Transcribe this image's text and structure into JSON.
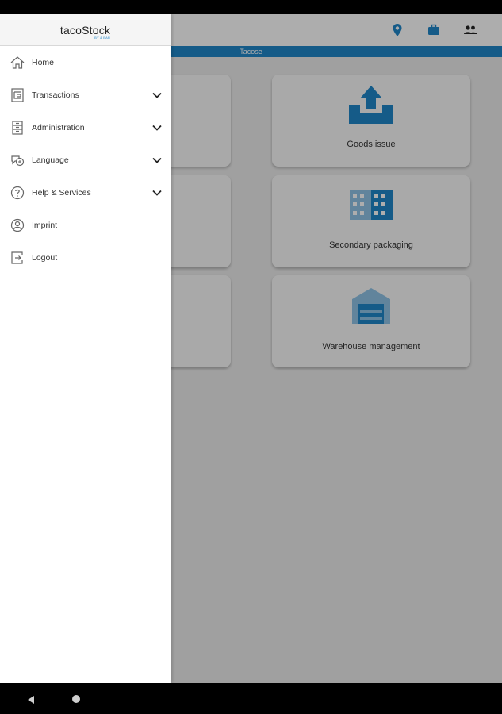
{
  "app": {
    "title": "tacoStock",
    "subtitle": "BY & BAR",
    "subheader": "Tacose"
  },
  "colors": {
    "accent": "#1f86c9",
    "drawer_bg": "#ffffff",
    "tile_bg": "#fafafa"
  },
  "topbar": {
    "icons": [
      "location-pin-icon",
      "briefcase-icon",
      "users-icon"
    ]
  },
  "tiles": [
    {
      "label": "Goods issue",
      "icon": "upload-tray-icon"
    },
    {
      "label": "Secondary packaging",
      "icon": "pallet-grid-icon"
    },
    {
      "label": "Warehouse management",
      "icon": "warehouse-icon"
    }
  ],
  "menu": {
    "items": [
      {
        "label": "Home",
        "icon": "home-icon",
        "expandable": false
      },
      {
        "label": "Transactions",
        "icon": "transactions-icon",
        "expandable": true
      },
      {
        "label": "Administration",
        "icon": "administration-icon",
        "expandable": true
      },
      {
        "label": "Language",
        "icon": "language-icon",
        "expandable": true
      },
      {
        "label": "Help & Services",
        "icon": "help-icon",
        "expandable": true
      },
      {
        "label": "Imprint",
        "icon": "imprint-icon",
        "expandable": false
      },
      {
        "label": "Logout",
        "icon": "logout-icon",
        "expandable": false
      }
    ]
  }
}
